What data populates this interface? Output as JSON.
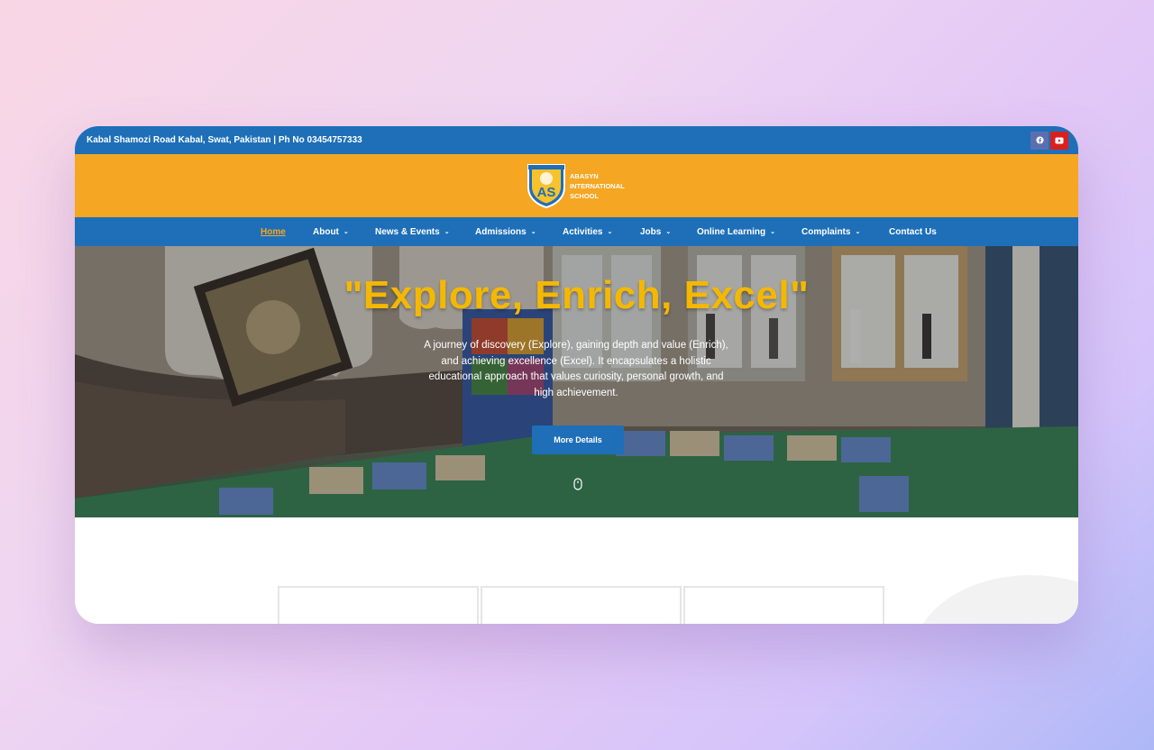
{
  "topbar": {
    "address": "Kabal Shamozi Road Kabal, Swat, Pakistan | Ph No 03454757333",
    "social": [
      {
        "icon": "facebook-icon",
        "color": "#5b6fb0"
      },
      {
        "icon": "youtube-icon",
        "color": "#d9201e"
      }
    ]
  },
  "logo": {
    "line1": "ABASYN",
    "line2": "INTERNATIONAL",
    "line3": "SCHOOL",
    "emblem_text": "AS"
  },
  "nav": {
    "items": [
      {
        "label": "Home",
        "active": true,
        "dropdown": false
      },
      {
        "label": "About",
        "dropdown": true
      },
      {
        "label": "News & Events",
        "dropdown": true
      },
      {
        "label": "Admissions",
        "dropdown": true
      },
      {
        "label": "Activities",
        "dropdown": true
      },
      {
        "label": "Jobs",
        "dropdown": true
      },
      {
        "label": "Online Learning",
        "dropdown": true
      },
      {
        "label": "Complaints",
        "dropdown": true
      },
      {
        "label": "Contact Us",
        "dropdown": false
      }
    ],
    "chevron": "⌄"
  },
  "hero": {
    "title": "\"Explore, Enrich, Excel\"",
    "text": "A journey of discovery (Explore), gaining depth and value (Enrich), and achieving excellence (Excel). It encapsulates a holistic educational approach that values curiosity, personal growth, and high achievement.",
    "button": "More Details"
  },
  "colors": {
    "primary_blue": "#1e6fb8",
    "accent_orange": "#f5a623",
    "title_yellow": "#f5b800"
  }
}
